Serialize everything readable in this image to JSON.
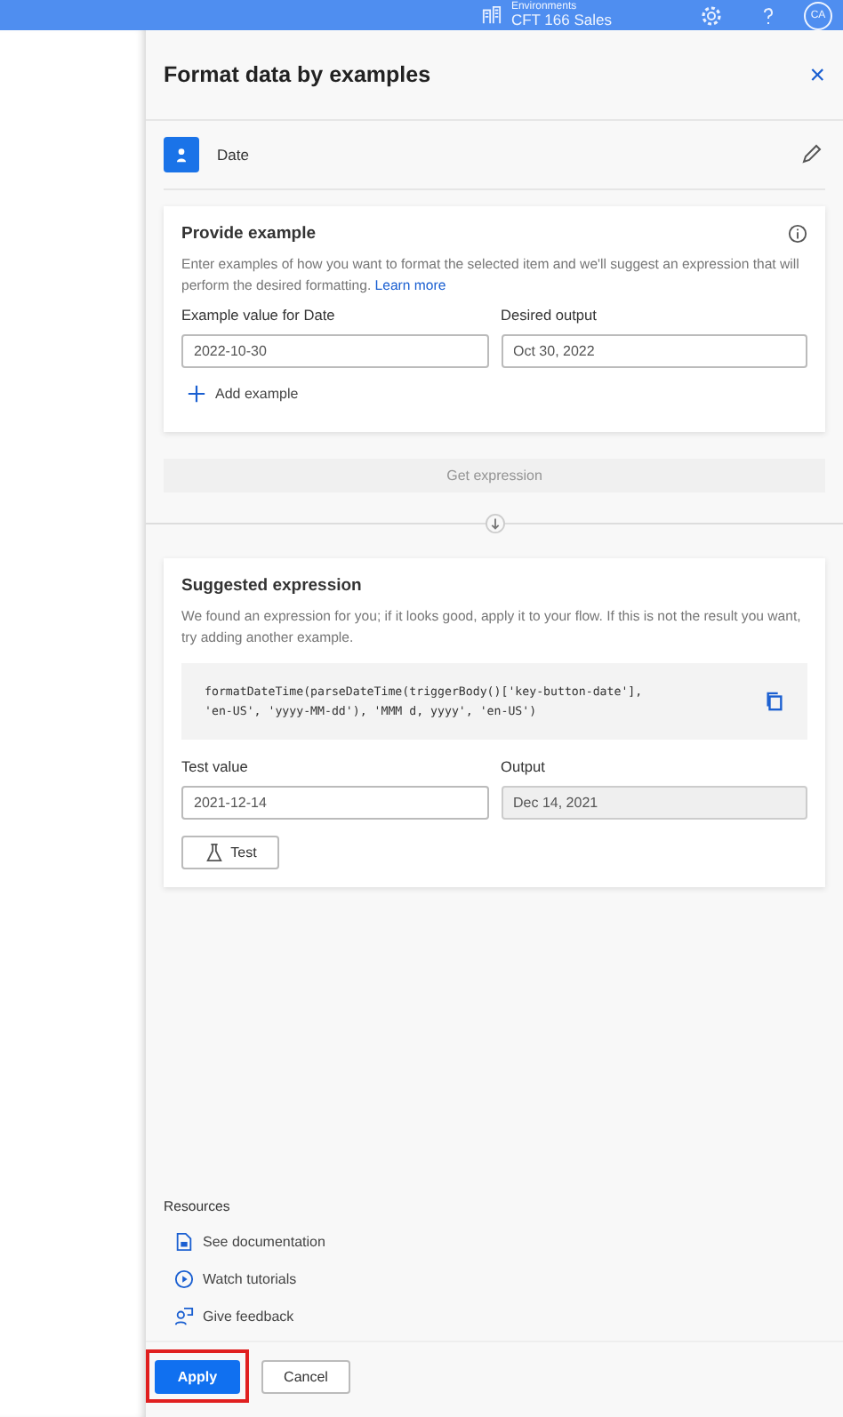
{
  "top_bar": {
    "environment_label": "Environments",
    "environment_name": "CFT 166 Sales",
    "avatar": "CA"
  },
  "panel": {
    "title": "Format data by examples",
    "close": "×",
    "item": {
      "label": "Date"
    }
  },
  "provide_example": {
    "title": "Provide example",
    "description": "Enter examples of how you want to format the selected item and we'll suggest an expression that will perform the desired formatting.",
    "link": "Learn more",
    "fields": [
      {
        "label": "Example value for Date",
        "value": "2022-10-30",
        "disabled": false
      },
      {
        "label": "Desired output",
        "value": "Oct 30, 2022",
        "disabled": false
      }
    ],
    "add_example": "Add example"
  },
  "get_expression": {
    "label": "Get expression",
    "disabled": true
  },
  "suggested_expression": {
    "title": "Suggested expression",
    "description": "We found an expression for you; if it looks good, apply it to your flow. If this is not the result you want, try adding another example.",
    "code_lines": [
      "formatDateTime(parseDateTime(triggerBody()['key-button-date'],",
      "'en-US', 'yyyy-MM-dd'), 'MMM d, yyyy', 'en-US')"
    ],
    "fields": [
      {
        "label": "Test value",
        "value": "2021-12-14",
        "disabled": false
      },
      {
        "label": "Output",
        "value": "Dec 14, 2021",
        "disabled": true
      }
    ],
    "test_button": "Test"
  },
  "resources": {
    "title": "Resources",
    "links": [
      {
        "kind": "doc",
        "label": "See documentation"
      },
      {
        "kind": "video",
        "label": "Watch tutorials"
      },
      {
        "kind": "feedback",
        "label": "Give feedback"
      }
    ]
  },
  "footer": {
    "buttons": [
      {
        "label": "Apply",
        "kind": "primary",
        "highlighted": true
      },
      {
        "label": "Cancel",
        "kind": "secondary",
        "highlighted": false
      }
    ]
  }
}
